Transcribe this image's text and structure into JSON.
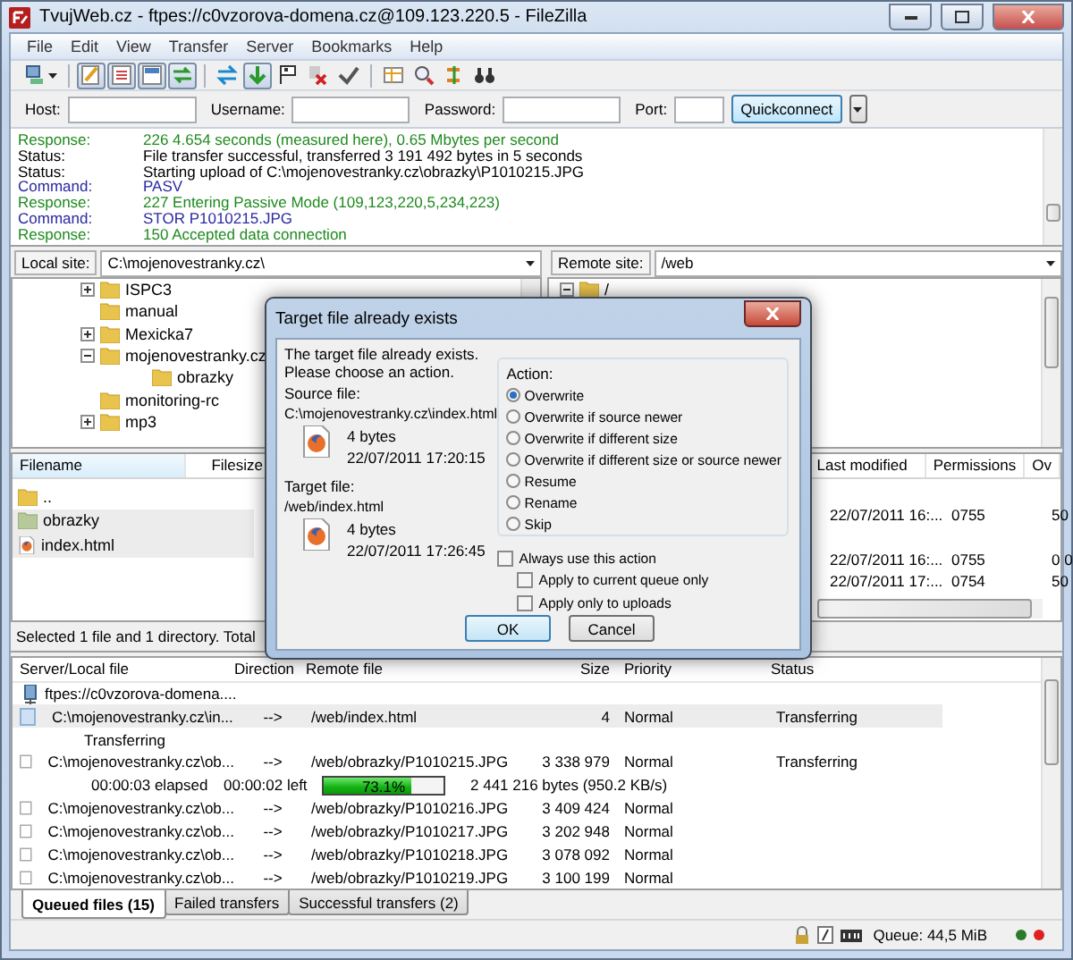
{
  "window": {
    "title": "TvujWeb.cz - ftpes://c0vzorova-domena.cz@109.123.220.5 - FileZilla"
  },
  "menu": [
    "File",
    "Edit",
    "View",
    "Transfer",
    "Server",
    "Bookmarks",
    "Help"
  ],
  "toolbar": [
    {
      "kind": "servers",
      "pressed": false
    },
    {
      "kind": "log",
      "pressed": true
    },
    {
      "kind": "local-tree",
      "pressed": true
    },
    {
      "kind": "remote-tree",
      "pressed": true
    },
    {
      "kind": "queue",
      "pressed": true
    },
    {
      "kind": "refresh",
      "pressed": false
    },
    {
      "kind": "process",
      "pressed": true
    },
    {
      "kind": "stop",
      "pressed": false
    },
    {
      "kind": "disconnect",
      "pressed": false
    },
    {
      "kind": "reconnect",
      "pressed": false
    },
    {
      "kind": "filter",
      "pressed": false
    },
    {
      "kind": "compare",
      "pressed": false
    },
    {
      "kind": "sync",
      "pressed": false
    },
    {
      "kind": "search",
      "pressed": false
    }
  ],
  "quickconnect": {
    "fields": [
      "Host:",
      "Username:",
      "Password:",
      "Port:"
    ],
    "button": "Quickconnect"
  },
  "log": [
    {
      "kind": "response",
      "label": "Response:",
      "text": "226 4.654 seconds (measured here), 0.65 Mbytes per second"
    },
    {
      "kind": "status",
      "label": "Status:",
      "text": "File transfer successful, transferred 3 191 492 bytes in 5 seconds"
    },
    {
      "kind": "status",
      "label": "Status:",
      "text": "Starting upload of C:\\mojenovestranky.cz\\obrazky\\P1010215.JPG"
    },
    {
      "kind": "command",
      "label": "Command:",
      "text": "PASV"
    },
    {
      "kind": "response",
      "label": "Response:",
      "text": "227 Entering Passive Mode (109,123,220,5,234,223)"
    },
    {
      "kind": "command",
      "label": "Command:",
      "text": "STOR P1010215.JPG"
    },
    {
      "kind": "response",
      "label": "Response:",
      "text": "150 Accepted data connection"
    }
  ],
  "local": {
    "site_label": "Local site:",
    "path": "C:\\mojenovestranky.cz\\",
    "tree": [
      {
        "name": "ISPC3",
        "has_children": true,
        "expanded": false
      },
      {
        "name": "manual",
        "has_children": false
      },
      {
        "name": "Mexicka7",
        "has_children": true,
        "expanded": false
      },
      {
        "name": "mojenovestranky.cz",
        "has_children": true,
        "expanded": true,
        "children": [
          {
            "name": "obrazky",
            "has_children": false
          }
        ]
      },
      {
        "name": "monitoring-rc",
        "has_children": false
      },
      {
        "name": "mp3",
        "has_children": true,
        "expanded": false
      }
    ],
    "columns": [
      "Filename",
      "Filesize"
    ],
    "files": [
      {
        "kind": "parent",
        "name": "..",
        "selected": false
      },
      {
        "kind": "folder",
        "name": "obrazky",
        "selected": true
      },
      {
        "kind": "html",
        "name": "index.html",
        "selected": true
      }
    ],
    "status": "Selected 1 file and 1 directory. Total"
  },
  "remote": {
    "site_label": "Remote site:",
    "path": "/web",
    "tree": [
      {
        "name": "/",
        "has_children": true,
        "expanded": true
      }
    ],
    "columns": [
      "Last modified",
      "Permissions",
      "Ov"
    ],
    "files": [
      {
        "kind": "blank"
      },
      {
        "kind": "entry",
        "modified": "22/07/2011 16:...",
        "permissions": "0755",
        "owner": "50"
      },
      {
        "kind": "blank"
      },
      {
        "kind": "entry",
        "modified": "22/07/2011 16:...",
        "permissions": "0755",
        "owner": "0 0"
      },
      {
        "kind": "entry",
        "modified": "22/07/2011 17:...",
        "permissions": "0754",
        "owner": "50"
      }
    ]
  },
  "queue": {
    "columns": [
      "Server/Local file",
      "Direction",
      "Remote file",
      "Size",
      "Priority",
      "Status"
    ],
    "server": "ftpes://c0vzorova-domena....",
    "rows": [
      {
        "local": "C:\\mojenovestranky.cz\\in...",
        "direction": "-->",
        "remote": "/web/index.html",
        "size": "4",
        "priority": "Normal",
        "status": "Transferring",
        "selected": true,
        "note": "Transferring"
      },
      {
        "local": "C:\\mojenovestranky.cz\\ob...",
        "direction": "-->",
        "remote": "/web/obrazky/P1010215.JPG",
        "size": "3 338 979",
        "priority": "Normal",
        "status": "Transferring",
        "selected": false,
        "progress": {
          "elapsed": "00:00:03 elapsed",
          "left": "00:00:02 left",
          "level": 0.731,
          "percent": "73.1%",
          "bytes": "2 441 216 bytes (950.2 KB/s)"
        }
      },
      {
        "local": "C:\\mojenovestranky.cz\\ob...",
        "direction": "-->",
        "remote": "/web/obrazky/P1010216.JPG",
        "size": "3 409 424",
        "priority": "Normal",
        "selected": false
      },
      {
        "local": "C:\\mojenovestranky.cz\\ob...",
        "direction": "-->",
        "remote": "/web/obrazky/P1010217.JPG",
        "size": "3 202 948",
        "priority": "Normal",
        "selected": false
      },
      {
        "local": "C:\\mojenovestranky.cz\\ob...",
        "direction": "-->",
        "remote": "/web/obrazky/P1010218.JPG",
        "size": "3 078 092",
        "priority": "Normal",
        "selected": false
      },
      {
        "local": "C:\\mojenovestranky.cz\\ob...",
        "direction": "-->",
        "remote": "/web/obrazky/P1010219.JPG",
        "size": "3 100 199",
        "priority": "Normal",
        "selected": false
      }
    ],
    "tabs": [
      {
        "label": "Queued files (15)",
        "selected": true
      },
      {
        "label": "Failed transfers",
        "selected": false
      },
      {
        "label": "Successful transfers (2)",
        "selected": false
      }
    ]
  },
  "status_bar": {
    "queue": "Queue: 44,5 MiB"
  },
  "dialog": {
    "title": "Target file already exists",
    "message": "The target file already exists.\nPlease choose an action.",
    "source": {
      "label": "Source file:",
      "path": "C:\\mojenovestranky.cz\\index.html",
      "size": "4 bytes",
      "date": "22/07/2011 17:20:15"
    },
    "target": {
      "label": "Target file:",
      "path": "/web/index.html",
      "size": "4 bytes",
      "date": "22/07/2011 17:26:45"
    },
    "action_label": "Action:",
    "actions": [
      {
        "label": "Overwrite",
        "selected": true
      },
      {
        "label": "Overwrite if source newer",
        "selected": false
      },
      {
        "label": "Overwrite if different size",
        "selected": false
      },
      {
        "label": "Overwrite if different size or source newer",
        "selected": false
      },
      {
        "label": "Resume",
        "selected": false
      },
      {
        "label": "Rename",
        "selected": false
      },
      {
        "label": "Skip",
        "selected": false
      }
    ],
    "options": [
      {
        "label": "Always use this action",
        "checked": false,
        "sub": false
      },
      {
        "label": "Apply to current queue only",
        "checked": false,
        "sub": true
      },
      {
        "label": "Apply only to uploads",
        "checked": false,
        "sub": true
      }
    ],
    "buttons": [
      {
        "label": "OK",
        "kind": "default"
      },
      {
        "label": "Cancel",
        "kind": "normal"
      }
    ]
  }
}
